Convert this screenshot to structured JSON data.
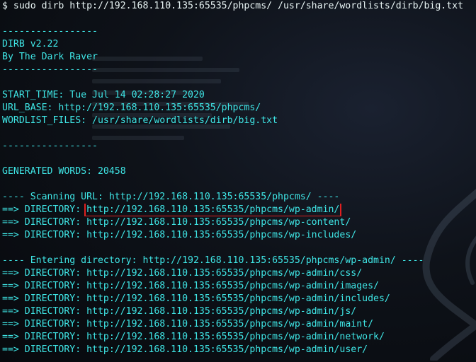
{
  "terminal": {
    "accent_color": "#3fe6e6",
    "highlight_color": "#e02020",
    "lines": [
      {
        "text": "$ sudo dirb http://192.168.110.135:65535/phpcms/ /usr/share/wordlists/dirb/big.txt",
        "kind": "prompt"
      },
      {
        "text": ""
      },
      {
        "text": "-----------------"
      },
      {
        "text": "DIRB v2.22"
      },
      {
        "text": "By The Dark Raver"
      },
      {
        "text": "-----------------"
      },
      {
        "text": ""
      },
      {
        "text": "START_TIME: Tue Jul 14 02:28:27 2020"
      },
      {
        "text": "URL_BASE: http://192.168.110.135:65535/phpcms/"
      },
      {
        "text": "WORDLIST_FILES: /usr/share/wordlists/dirb/big.txt"
      },
      {
        "text": ""
      },
      {
        "text": "-----------------"
      },
      {
        "text": ""
      },
      {
        "text": "GENERATED WORDS: 20458"
      },
      {
        "text": ""
      },
      {
        "text": "---- Scanning URL: http://192.168.110.135:65535/phpcms/ ----"
      },
      {
        "prefix": "==> DIRECTORY: ",
        "url": "http://192.168.110.135:65535/phpcms/wp-admin/",
        "highlighted": true
      },
      {
        "prefix": "==> DIRECTORY: ",
        "url": "http://192.168.110.135:65535/phpcms/wp-content/"
      },
      {
        "prefix": "==> DIRECTORY: ",
        "url": "http://192.168.110.135:65535/phpcms/wp-includes/"
      },
      {
        "text": ""
      },
      {
        "text": "---- Entering directory: http://192.168.110.135:65535/phpcms/wp-admin/ ----"
      },
      {
        "prefix": "==> DIRECTORY: ",
        "url": "http://192.168.110.135:65535/phpcms/wp-admin/css/"
      },
      {
        "prefix": "==> DIRECTORY: ",
        "url": "http://192.168.110.135:65535/phpcms/wp-admin/images/"
      },
      {
        "prefix": "==> DIRECTORY: ",
        "url": "http://192.168.110.135:65535/phpcms/wp-admin/includes/"
      },
      {
        "prefix": "==> DIRECTORY: ",
        "url": "http://192.168.110.135:65535/phpcms/wp-admin/js/"
      },
      {
        "prefix": "==> DIRECTORY: ",
        "url": "http://192.168.110.135:65535/phpcms/wp-admin/maint/"
      },
      {
        "prefix": "==> DIRECTORY: ",
        "url": "http://192.168.110.135:65535/phpcms/wp-admin/network/"
      },
      {
        "prefix": "==> DIRECTORY: ",
        "url": "http://192.168.110.135:65535/phpcms/wp-admin/user/"
      }
    ]
  },
  "background_icon": "kali-dragon-watermark-icon"
}
